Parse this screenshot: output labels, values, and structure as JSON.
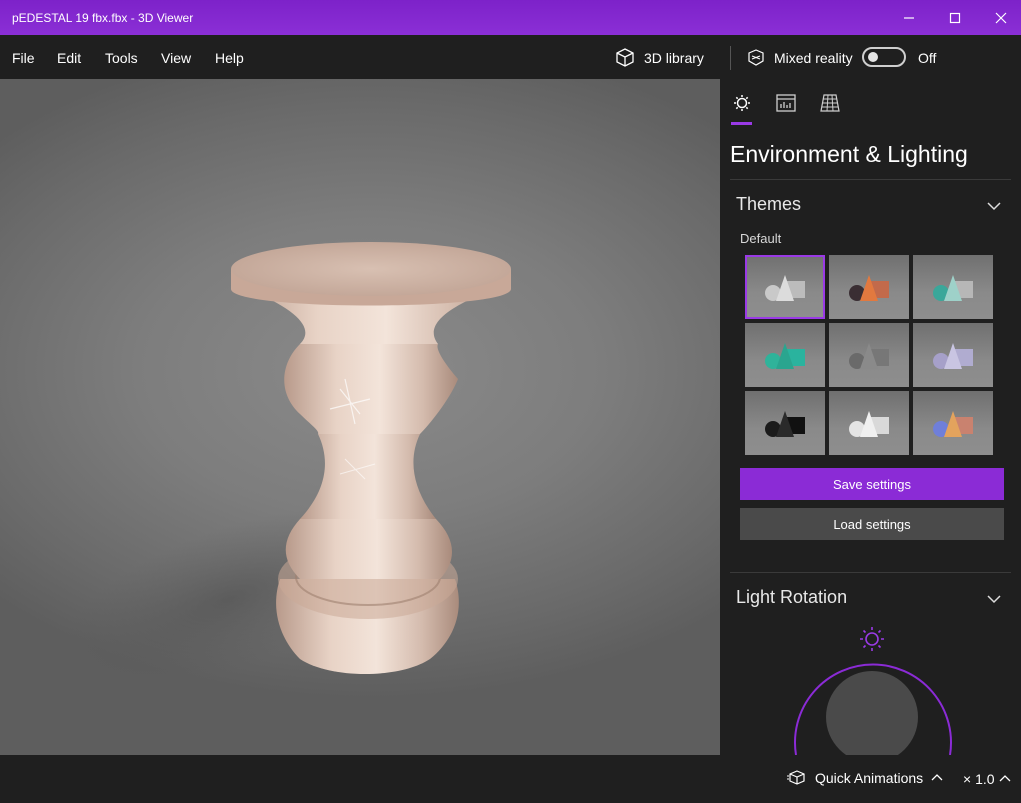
{
  "window": {
    "title": "pEDESTAL 19 fbx.fbx - 3D Viewer",
    "minimize_glyph": "—",
    "maximize_glyph": "☐",
    "close_glyph": "✕"
  },
  "menu": {
    "items": [
      "File",
      "Edit",
      "Tools",
      "View",
      "Help"
    ],
    "library_label": "3D library",
    "mixed_reality_label": "Mixed reality",
    "toggle_state": "Off"
  },
  "panel": {
    "tabs": [
      "lighting-icon",
      "stats-icon",
      "grid-icon"
    ],
    "title": "Environment & Lighting",
    "themes": {
      "heading": "Themes",
      "subheading": "Default",
      "selected_index": 0,
      "tiles": [
        {
          "name": "default-white",
          "colors": [
            "#c9c9c9",
            "#dcdcdc",
            "#bcbcbc"
          ]
        },
        {
          "name": "dark-orange",
          "colors": [
            "#3a2e33",
            "#e2793f",
            "#c26a4b"
          ]
        },
        {
          "name": "teal-gray",
          "colors": [
            "#3aa79a",
            "#9ed1c9",
            "#b7b7b7"
          ]
        },
        {
          "name": "green-teal",
          "colors": [
            "#2fb39a",
            "#2aa58f",
            "#2ab39e"
          ]
        },
        {
          "name": "dark-gray",
          "colors": [
            "#6a6a6a",
            "#8a8a8a",
            "#777777"
          ]
        },
        {
          "name": "lavender",
          "colors": [
            "#a6a0c9",
            "#c9c5e2",
            "#b0acd0"
          ]
        },
        {
          "name": "black",
          "colors": [
            "#1b1b1b",
            "#2a2a2a",
            "#111111"
          ]
        },
        {
          "name": "white-bright",
          "colors": [
            "#e4e4e4",
            "#f0f0f0",
            "#d9d9d9"
          ]
        },
        {
          "name": "multicolor",
          "colors": [
            "#6f7fd9",
            "#e3a35d",
            "#c9826f"
          ]
        }
      ],
      "save_label": "Save settings",
      "load_label": "Load settings"
    },
    "light_rotation": {
      "heading": "Light Rotation"
    },
    "colors": {
      "accent": "#8b2bd6",
      "panel_bg": "#1f1f1f"
    }
  },
  "status": {
    "quick_animations_label": "Quick Animations",
    "speed_label": "× 1.0"
  }
}
